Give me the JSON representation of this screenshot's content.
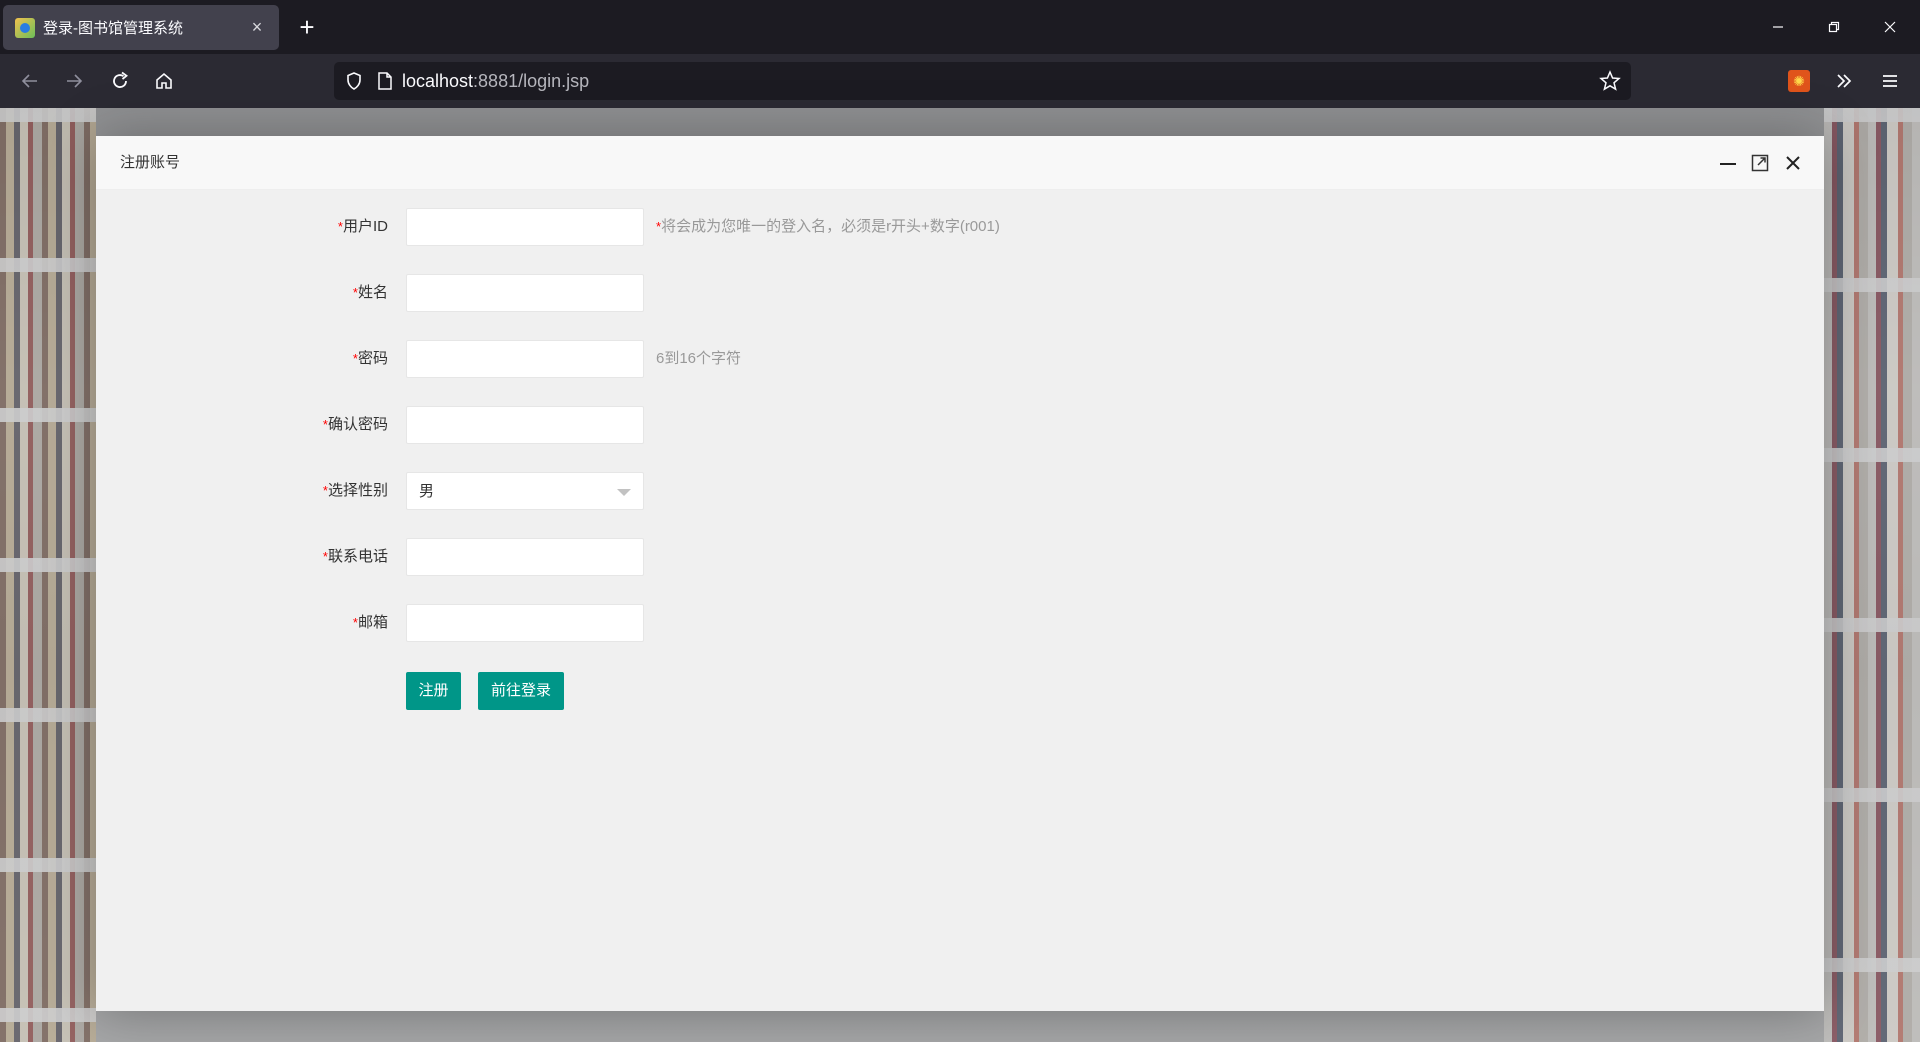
{
  "browser": {
    "tab_title": "登录-图书馆管理系统",
    "tab_close": "×",
    "new_tab": "+",
    "url_host": "localhost",
    "url_rest": ":8881/login.jsp"
  },
  "dialog": {
    "title": "注册账号"
  },
  "form": {
    "required_mark": "*",
    "fields": [
      {
        "label": "用户ID",
        "value": "",
        "hint": "将会成为您唯一的登入名，必须是r开头+数字(r001)",
        "hint_star": "*"
      },
      {
        "label": "姓名",
        "value": ""
      },
      {
        "label": "密码",
        "value": "",
        "hint": "6到16个字符"
      },
      {
        "label": "确认密码",
        "value": ""
      },
      {
        "label": "选择性别",
        "selected": "男"
      },
      {
        "label": "联系电话",
        "value": ""
      },
      {
        "label": "邮箱",
        "value": ""
      }
    ],
    "register_label": "注册",
    "goto_login_label": "前往登录"
  },
  "colors": {
    "primary": "#009688",
    "required": "#ff0000",
    "hint": "#999999"
  }
}
